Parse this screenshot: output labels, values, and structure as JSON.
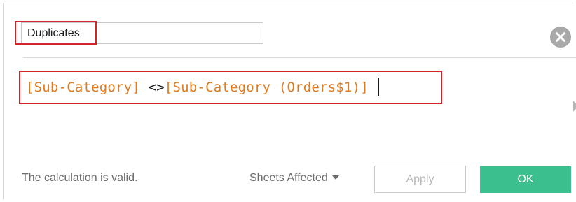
{
  "calculation": {
    "name": "Duplicates",
    "formula": {
      "field_1": "[Sub-Category]",
      "operator": " <>",
      "field_2": "[Sub-Category (Orders$1)]"
    }
  },
  "status": {
    "message": "The calculation is valid."
  },
  "footer": {
    "sheets_affected_label": "Sheets Affected",
    "apply_label": "Apply",
    "ok_label": "OK"
  },
  "icons": {
    "close": "close-circle-icon",
    "dropdown": "chevron-down-icon",
    "expand": "chevron-right-icon"
  },
  "colors": {
    "field_reference": "#e07b1f",
    "highlight_border": "#d2232a",
    "ok_button": "#3bbf8f",
    "close_button": "#a8a8a8"
  }
}
